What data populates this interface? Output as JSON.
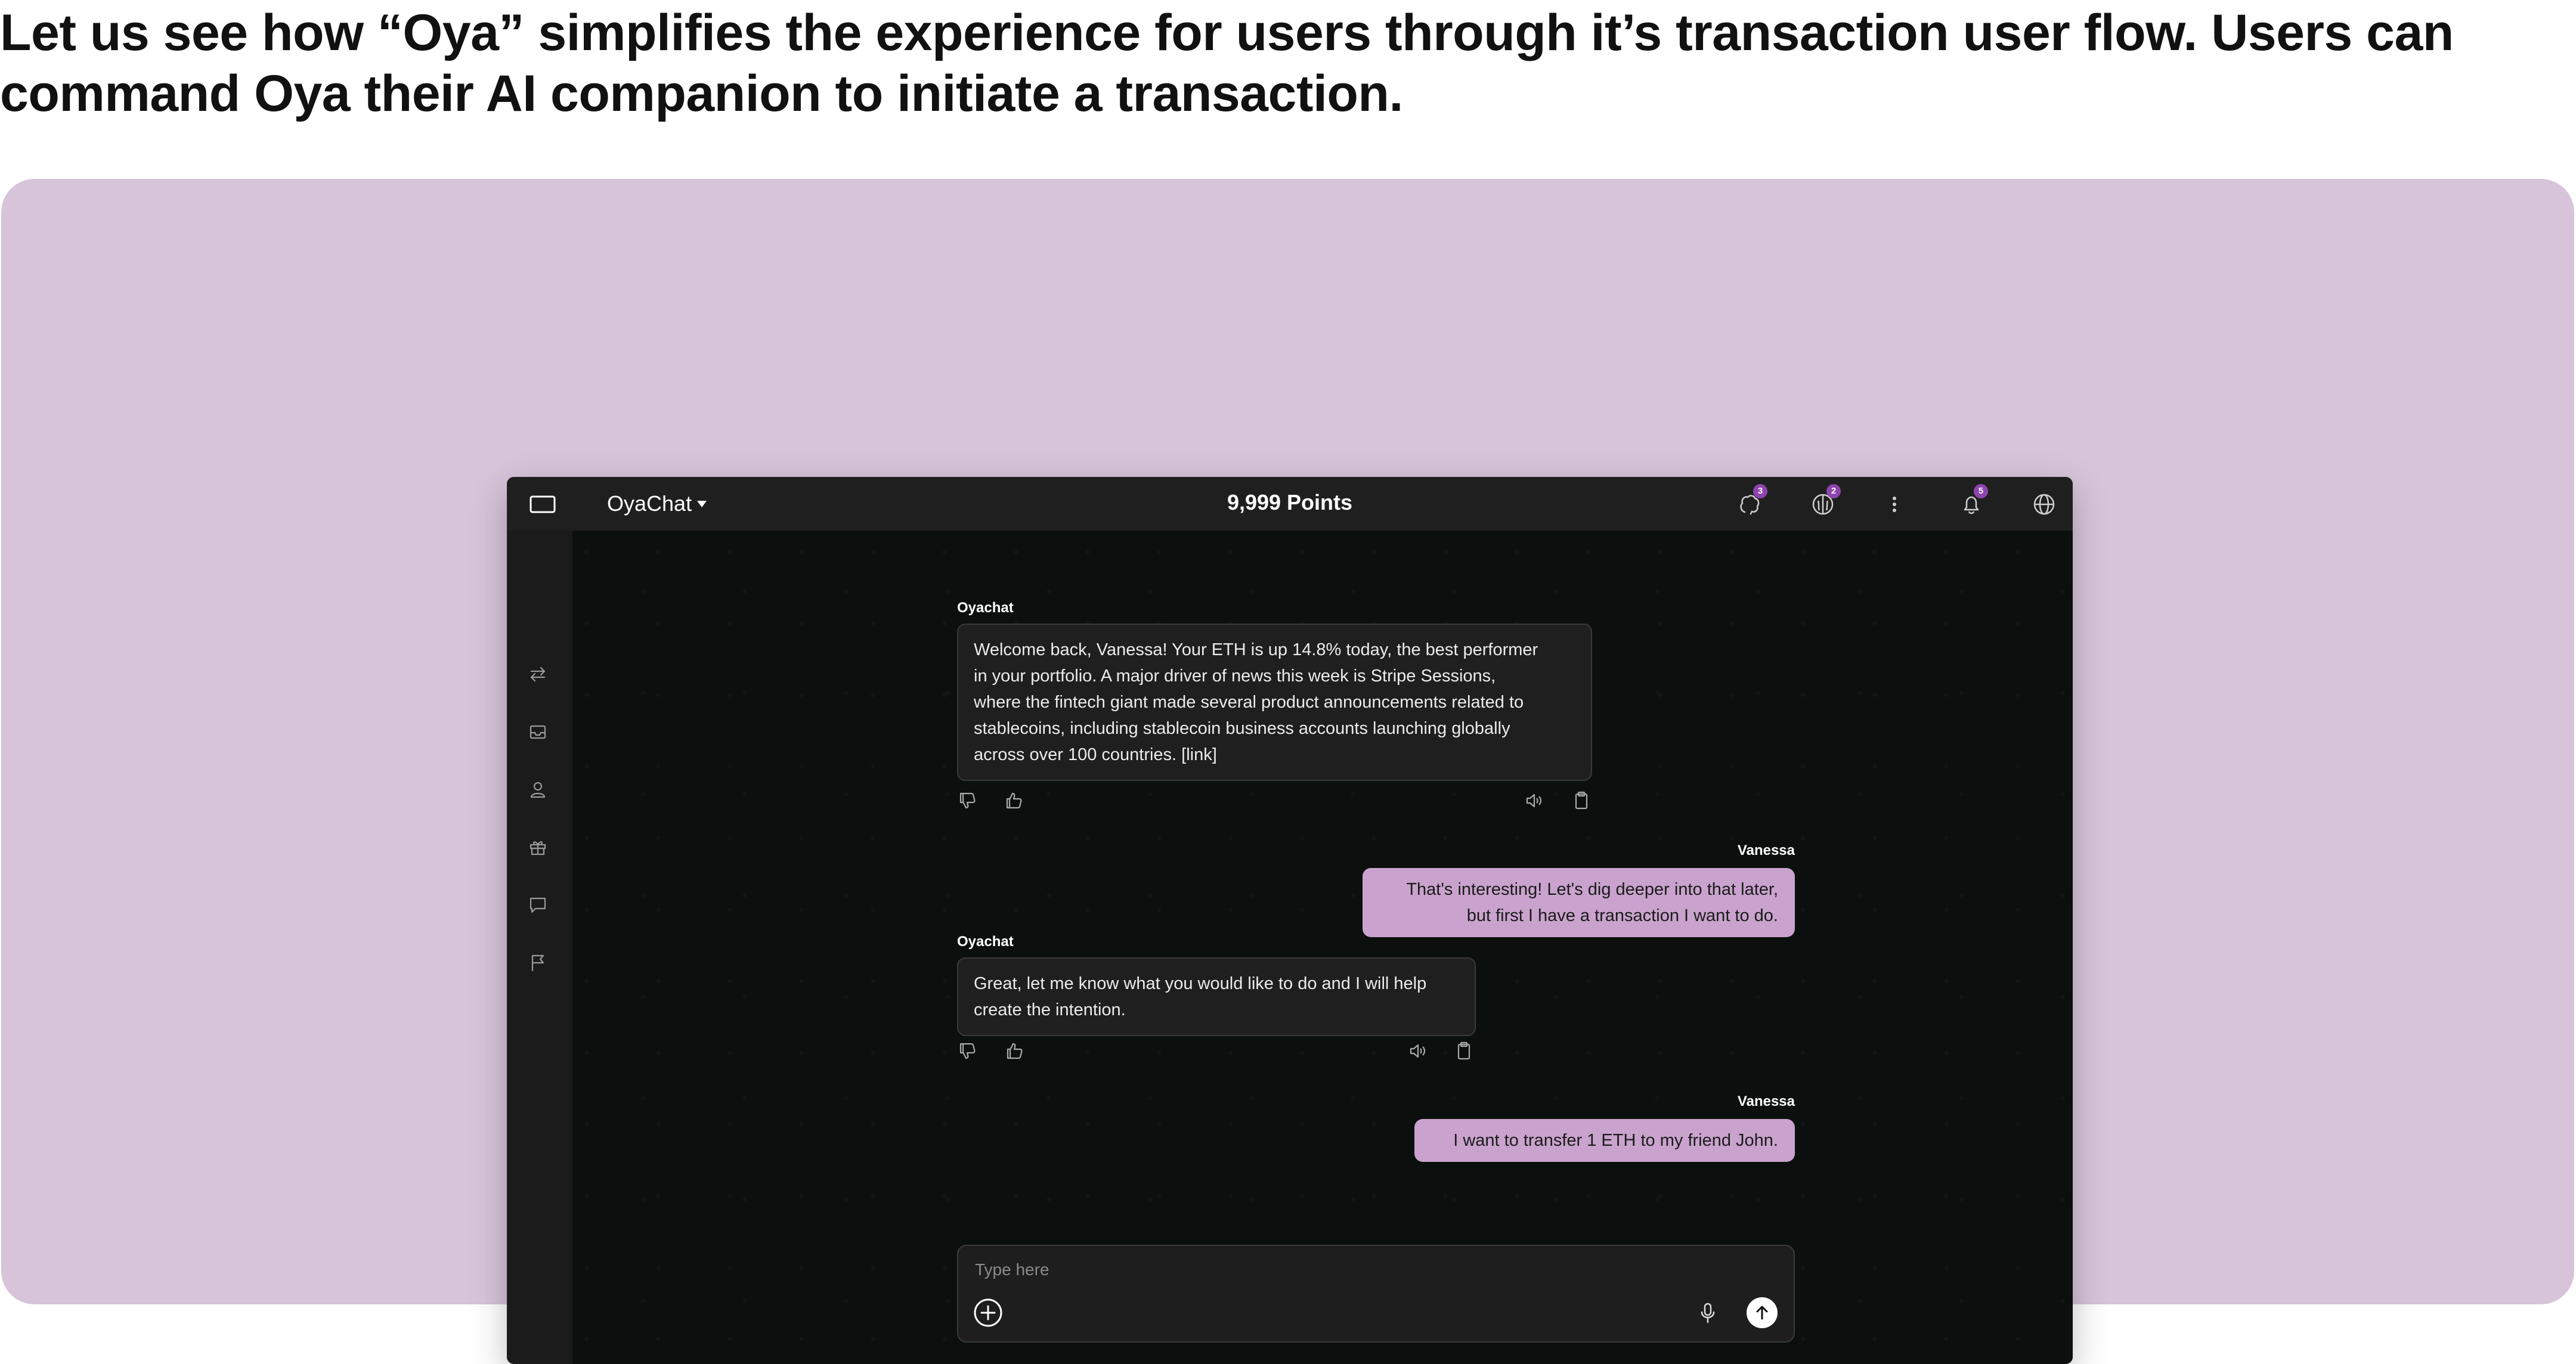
{
  "headline": "Let us see how “Oya” simplifies the experience for users through it’s transaction user flow. Users can command Oya their AI companion to initiate a transaction.",
  "colors": {
    "panel": "#d7c4d9",
    "app_bg": "#0b0f0e",
    "topbar": "#1f1f1f",
    "user_bubble": "#c9a3cd",
    "badge": "#8e44ad"
  },
  "app": {
    "brand": "OyaChat",
    "points": "9,999 Points",
    "topbar_icons": [
      {
        "name": "brain-icon",
        "badge": "3"
      },
      {
        "name": "face-icon",
        "badge": "2"
      },
      {
        "name": "more-icon"
      },
      {
        "name": "bell-icon",
        "badge": "5"
      },
      {
        "name": "globe-icon"
      }
    ],
    "sidebar_icons": [
      "swap-icon",
      "inbox-icon",
      "user-icon",
      "gift-icon",
      "chat-icon",
      "flag-icon"
    ]
  },
  "messages": [
    {
      "sender": "Oyachat",
      "role": "bot",
      "lines": [
        "Welcome back, Vanessa! Your ETH is up 14.8% today, the best performer",
        "in your portfolio. A major driver of news this week is Stripe Sessions,",
        "where the fintech giant made several product announcements related to",
        "stablecoins, including stablecoin business accounts launching globally",
        "across over 100 countries. [link]"
      ]
    },
    {
      "sender": "Vanessa",
      "role": "user",
      "lines": [
        "That's interesting! Let's dig deeper into that later,",
        "but first I have a transaction I want to do."
      ]
    },
    {
      "sender": "Oyachat",
      "role": "bot",
      "lines": [
        "Great, let me know what you would like to do and I will help",
        "create the intention."
      ]
    },
    {
      "sender": "Vanessa",
      "role": "user",
      "lines": [
        "I want to transfer 1 ETH to my friend John."
      ]
    }
  ],
  "composer": {
    "placeholder": "Type here"
  }
}
